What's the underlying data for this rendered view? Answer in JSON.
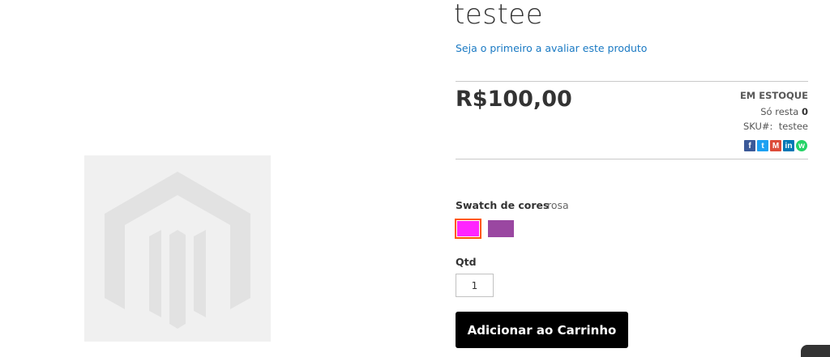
{
  "product": {
    "title": "testee",
    "review_link": "Seja o primeiro a avaliar este produto",
    "price": "R$100,00",
    "stock_status": "EM ESTOQUE",
    "remaining_prefix": "Só resta",
    "remaining_count": "0",
    "sku_label": "SKU#:",
    "sku_value": "testee"
  },
  "share": {
    "facebook": "f",
    "twitter": "t",
    "gmail": "M",
    "linkedin": "in",
    "whatsapp": "w"
  },
  "options": {
    "swatch_label": "Swatch de cores",
    "swatch_selected": "rosa",
    "swatches": [
      {
        "name": "rosa",
        "color": "#ff25ff"
      },
      {
        "name": "roxo",
        "color": "#9a47a1"
      }
    ]
  },
  "quantity": {
    "label": "Qtd",
    "value": "1"
  },
  "actions": {
    "add_to_cart": "Adicionar ao Carrinho"
  },
  "colors": {
    "accent_link": "#1979c3",
    "selected_border": "#ff5501"
  }
}
